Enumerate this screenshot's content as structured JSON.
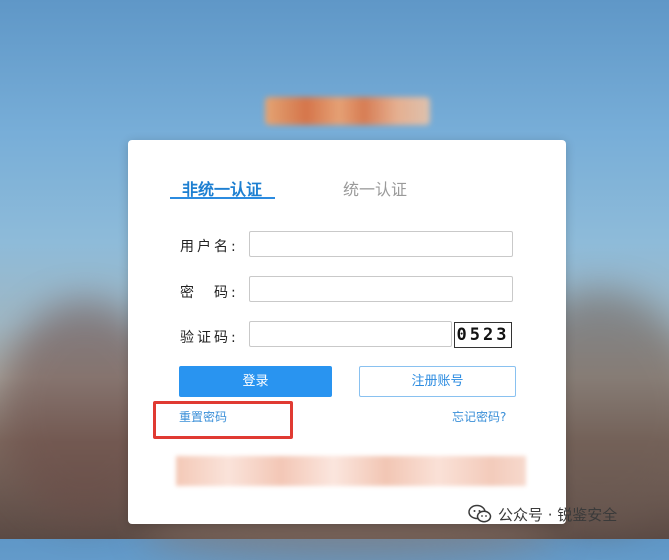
{
  "tabs": {
    "active": "非统一认证",
    "inactive": "统一认证"
  },
  "form": {
    "username_label": "用户名:",
    "password_label": "密　码:",
    "captcha_label": "验证码:",
    "username_value": "",
    "password_value": "",
    "captcha_value": "",
    "captcha_image_text": "0523"
  },
  "buttons": {
    "login": "登录",
    "register": "注册账号"
  },
  "links": {
    "reset_password": "重置密码",
    "forgot_password": "忘记密码?"
  },
  "watermark": {
    "text": "公众号 · 锐鉴安全",
    "icon": "wechat-icon"
  },
  "colors": {
    "accent": "#2994f0",
    "highlight": "#e03a32"
  }
}
